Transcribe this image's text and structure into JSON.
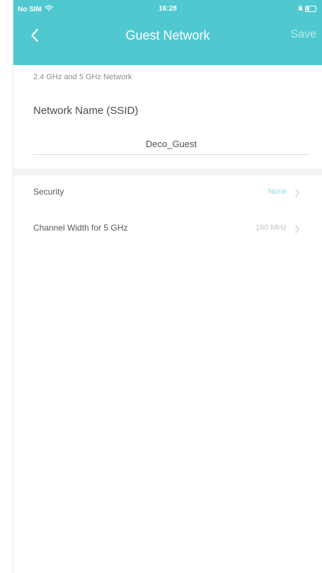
{
  "status_bar": {
    "carrier": "No SIM",
    "time": "16:28"
  },
  "nav": {
    "title": "Guest Network",
    "save_label": "Save"
  },
  "form": {
    "section_label": "2.4 GHz and 5 GHz Network",
    "network_name_label": "Network Name (SSID)",
    "network_name_value": "Deco_Guest"
  },
  "settings": [
    {
      "label": "Security",
      "value": "None",
      "value_color": "#8ad8df"
    },
    {
      "label": "Channel Width for 5 GHz",
      "value": "160 MHz",
      "value_color": "#c4c4c4"
    }
  ],
  "colors": {
    "header": "#50c8cf",
    "background": "#ffffff"
  },
  "icons": {
    "back": "back-chevron-icon",
    "wifi": "wifi-icon",
    "battery": "battery-icon",
    "row_arrow": "chevron-right-icon"
  }
}
